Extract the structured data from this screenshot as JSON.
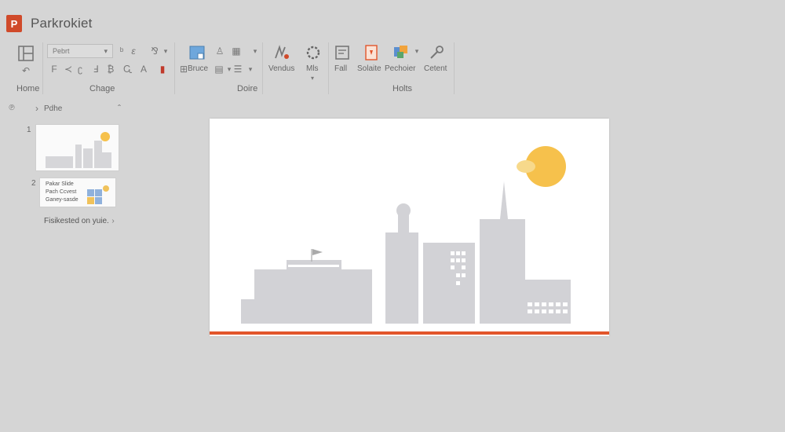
{
  "app": {
    "logo_letter": "P",
    "title": "Parkrokiet"
  },
  "ribbon": {
    "font_name": "Pebrt",
    "buttons": {
      "bruce": "Bruce",
      "vendus": "Vendus",
      "mls": "Mls",
      "fall": "Fall",
      "solaite": "Solaite",
      "pechoier": "Pechoier",
      "cetent": "Cetent"
    },
    "groups": {
      "home": "Home",
      "chage": "Chage",
      "doire": "Doire",
      "holts": "Holts"
    }
  },
  "left_pane": {
    "header": "Pdhe",
    "slide_numbers": [
      "1",
      "2"
    ],
    "thumb2_lines": [
      "Pakar Slide",
      "Pach Ccvest",
      "Ganey-sasde"
    ],
    "footer_link": "Fisikested on yuie."
  },
  "colors": {
    "accent": "#d04a2a",
    "sun": "#f6c14c",
    "building": "#d2d2d6",
    "slide_border": "#e2552b"
  },
  "icons": {
    "layout": "layout-icon",
    "paint": "brush-icon",
    "shapes": "shapes-icon",
    "picture": "picture-icon",
    "table": "table-icon",
    "loop": "loop-icon",
    "doc": "document-icon",
    "wand": "wand-icon"
  }
}
